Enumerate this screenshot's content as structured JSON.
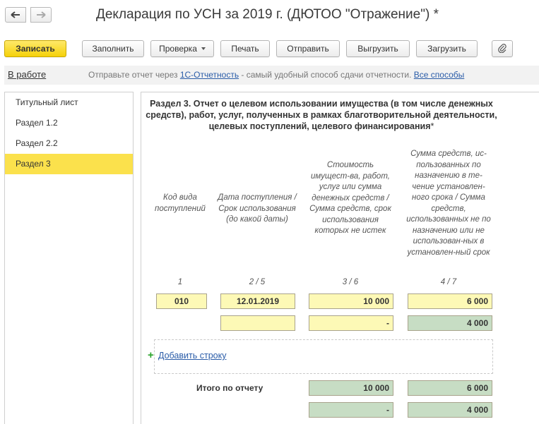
{
  "window": {
    "title": "Декларация по УСН за 2019 г. (ДЮТОО \"Отражение\") *",
    "back_icon": "arrow-left-icon",
    "forward_icon": "arrow-right-icon"
  },
  "toolbar": {
    "save": "Записать",
    "fill": "Заполнить",
    "check": "Проверка",
    "print": "Печать",
    "send": "Отправить",
    "export": "Выгрузить",
    "import": "Загрузить",
    "attach_icon": "paperclip-icon"
  },
  "status": {
    "label": "В работе",
    "prefix": "Отправьте отчет через ",
    "service_link": "1С-Отчетность",
    "middle": " - самый удобный способ сдачи отчетности. ",
    "all_ways_link": "Все способы"
  },
  "sidebar": {
    "items": [
      {
        "label": "Титульный лист"
      },
      {
        "label": "Раздел 1.2"
      },
      {
        "label": "Раздел 2.2"
      },
      {
        "label": "Раздел 3"
      }
    ],
    "active_index": 3
  },
  "section": {
    "title": "Раздел 3. Отчет о целевом использовании имущества (в том числе денежных средств), работ, услуг, полученных в рамках благотворительной деятельности, целевых поступлений, целевого финансирования",
    "required_mark": "*",
    "columns": [
      {
        "header": "Код вида поступлений",
        "number": "1"
      },
      {
        "header": "Дата поступления / Срок использования (до какой даты)",
        "number": "2 / 5"
      },
      {
        "header": "Стоимость имущест-ва, работ, услуг или сумма денежных средств / Сумма средств, срок использования которых не истек",
        "number": "3 / 6"
      },
      {
        "header": "Сумма средств, ис-пользованных по назначению в те-чение установлен-ного срока / Сумма средств, использованных не по назначению или не использован-ных в установлен-ный срок",
        "number": "4 / 7"
      }
    ],
    "rows": [
      {
        "code": "010",
        "date": "12.01.2019",
        "amount": "10 000",
        "used": "6 000"
      },
      {
        "code": "",
        "date": "",
        "amount": "-",
        "used": "4 000"
      }
    ],
    "add_row": "Добавить строку",
    "add_icon": "plus-icon",
    "total_label": "Итого по отчету",
    "totals": [
      {
        "amount": "10 000",
        "used": "6 000"
      },
      {
        "amount": "-",
        "used": "4 000"
      }
    ]
  },
  "colors": {
    "accent_yellow": "#f5d10a",
    "active_item": "#fbe14c",
    "input_yellow": "#fdf9b6",
    "computed_green": "#c7ddc4",
    "link_blue": "#2a5ca8"
  }
}
